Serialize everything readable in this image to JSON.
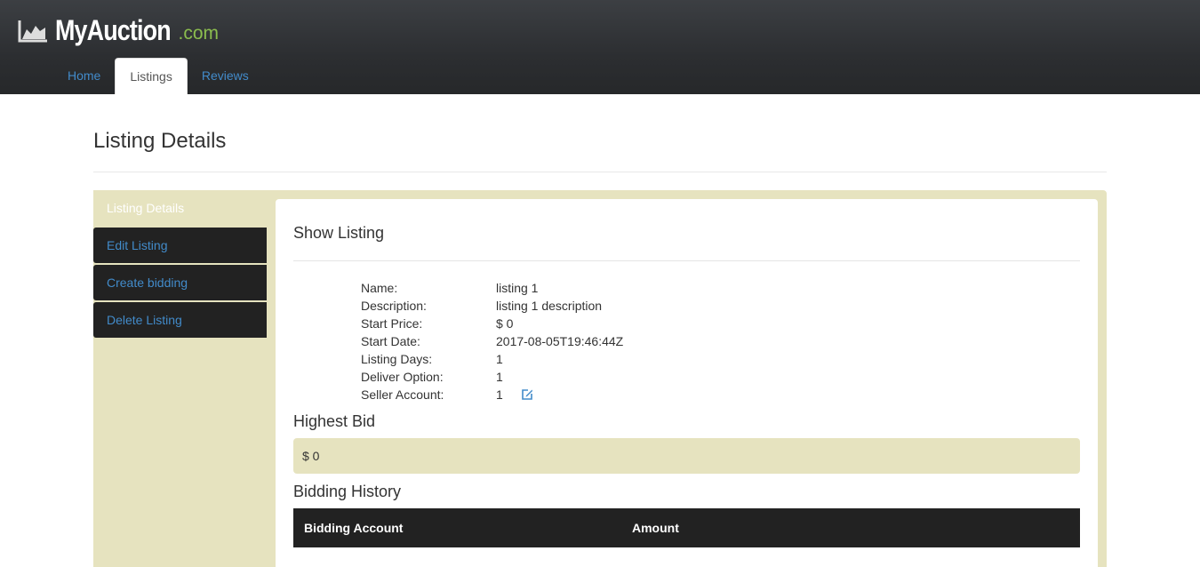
{
  "brand": {
    "name": "MyAuction",
    "suffix": ".com",
    "icon": "area-chart-icon",
    "accent": "#8bbd4e"
  },
  "nav": {
    "tabs": [
      {
        "label": "Home",
        "active": false
      },
      {
        "label": "Listings",
        "active": true
      },
      {
        "label": "Reviews",
        "active": false
      }
    ]
  },
  "page": {
    "title": "Listing Details"
  },
  "sidebar": {
    "items": [
      {
        "label": "Listing Details",
        "active": true
      },
      {
        "label": "Edit Listing"
      },
      {
        "label": "Create bidding"
      },
      {
        "label": "Delete Listing"
      }
    ]
  },
  "listing": {
    "heading": "Show Listing",
    "fields": [
      {
        "label": "Name:",
        "value": "listing 1"
      },
      {
        "label": "Description:",
        "value": "listing 1 description"
      },
      {
        "label": "Start Price:",
        "value": "$ 0"
      },
      {
        "label": "Start Date:",
        "value": "2017-08-05T19:46:44Z"
      },
      {
        "label": "Listing Days:",
        "value": "1"
      },
      {
        "label": "Deliver Option:",
        "value": "1"
      },
      {
        "label": "Seller Account:",
        "value": "1",
        "icon": "edit-icon"
      }
    ]
  },
  "highest_bid": {
    "heading": "Highest Bid",
    "value": "$ 0"
  },
  "bidding_history": {
    "heading": "Bidding History",
    "columns": [
      "Bidding Account",
      "Amount"
    ]
  },
  "colors": {
    "panel": "#e6e3bf",
    "link": "#428bca",
    "dark": "#222222"
  }
}
